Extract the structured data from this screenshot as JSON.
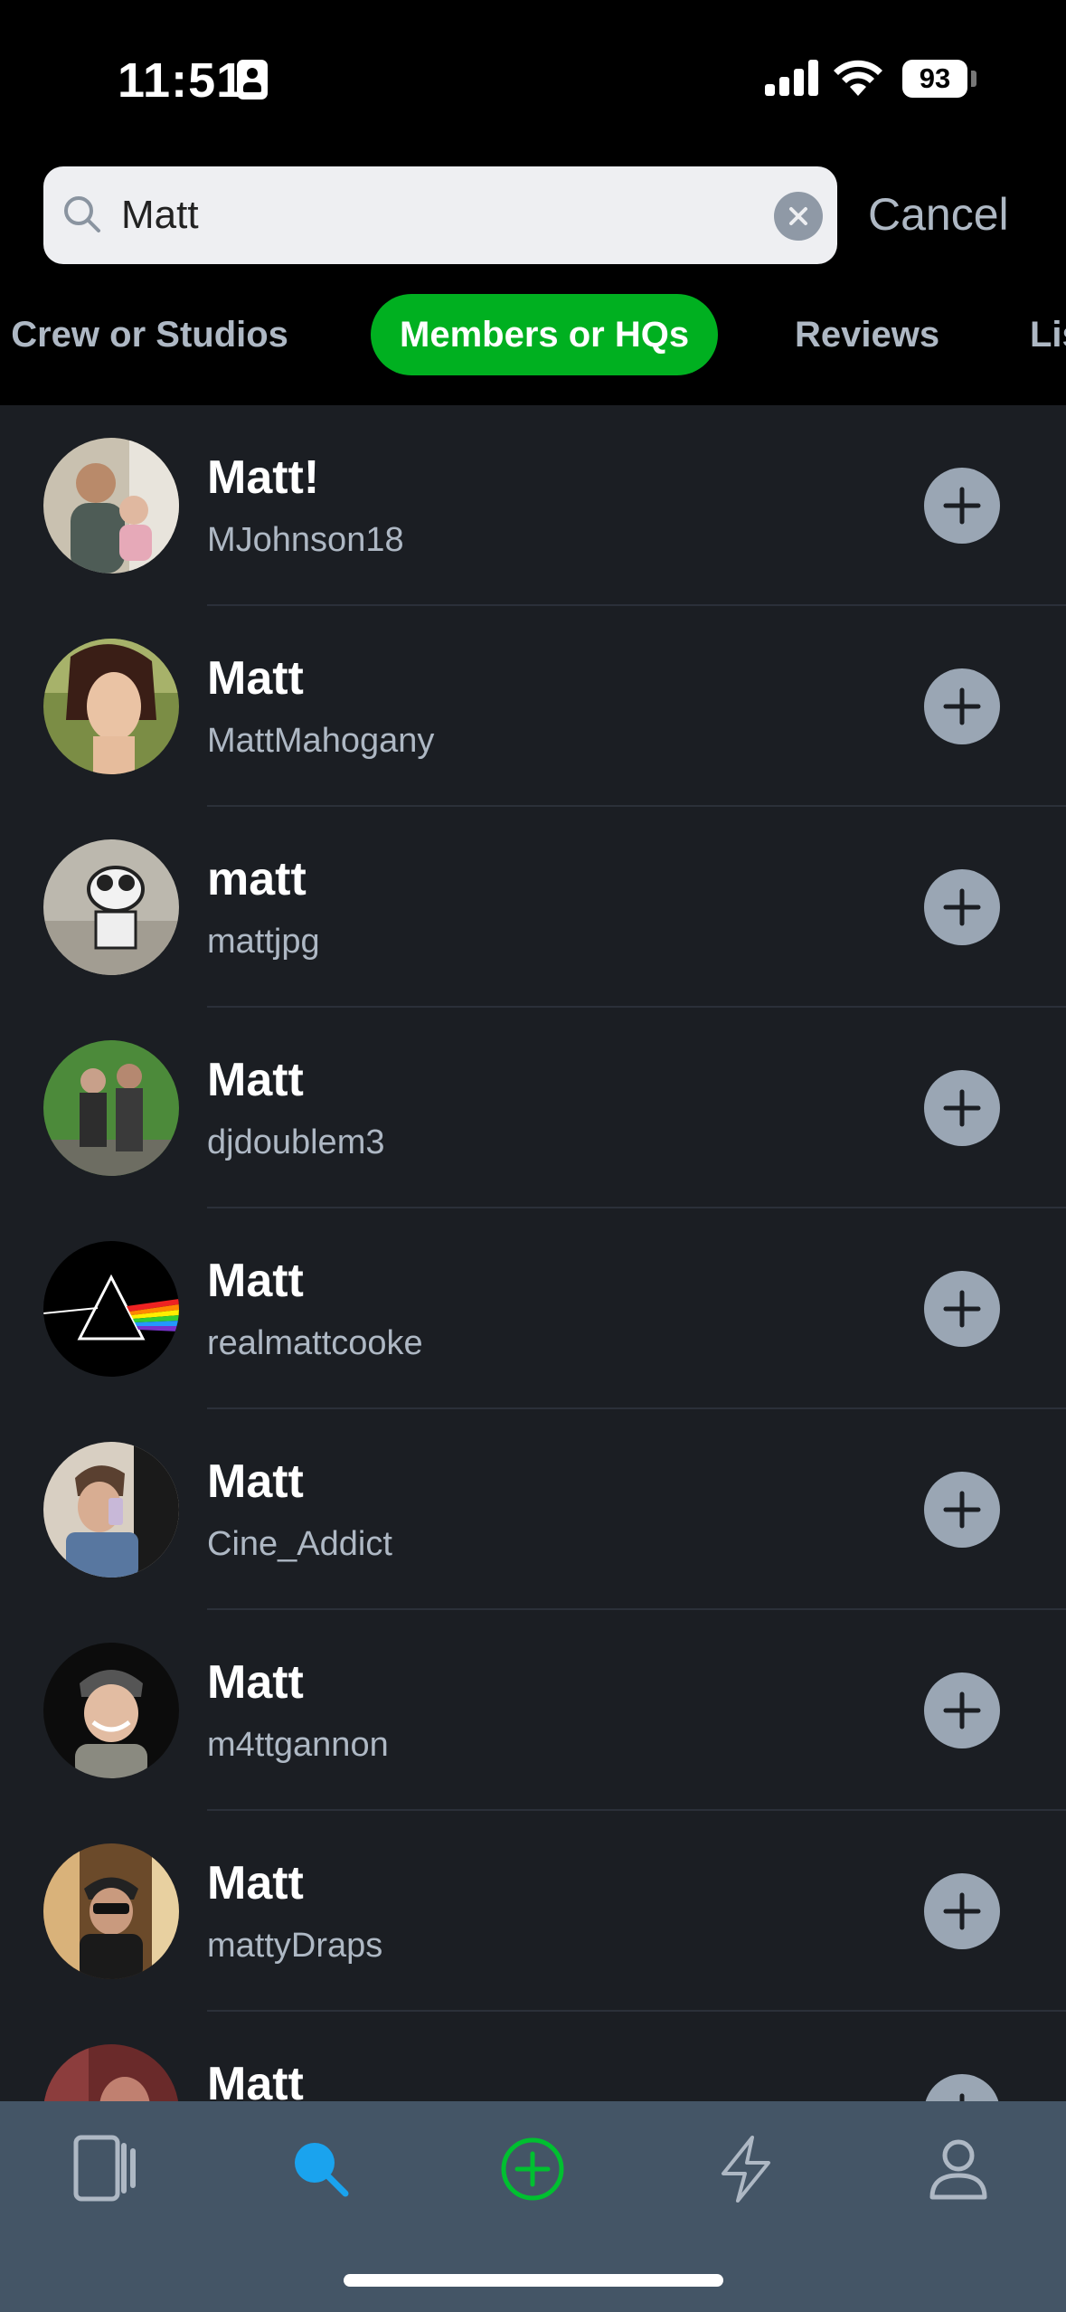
{
  "status_bar": {
    "time": "11:51",
    "battery": "93"
  },
  "search": {
    "value": "Matt",
    "clear_icon": "clear-circle-icon",
    "cancel_label": "Cancel"
  },
  "tabs": [
    {
      "label": ", Crew or Studios",
      "active": false
    },
    {
      "label": "Members or HQs",
      "active": true
    },
    {
      "label": "Reviews",
      "active": false
    },
    {
      "label": "Lis",
      "active": false
    }
  ],
  "results": [
    {
      "name": "Matt!",
      "handle": "MJohnson18"
    },
    {
      "name": "Matt",
      "handle": "MattMahogany"
    },
    {
      "name": "matt",
      "handle": "mattjpg"
    },
    {
      "name": "Matt",
      "handle": "djdoublem3"
    },
    {
      "name": "Matt",
      "handle": "realmattcooke"
    },
    {
      "name": "Matt",
      "handle": "Cine_Addict"
    },
    {
      "name": "Matt",
      "handle": "m4ttgannon"
    },
    {
      "name": "Matt",
      "handle": "mattyDraps"
    },
    {
      "name": "Matt",
      "handle": ""
    }
  ],
  "bottom_nav": [
    {
      "icon": "films-icon",
      "active": false
    },
    {
      "icon": "search-icon",
      "active": true
    },
    {
      "icon": "add-circle-icon",
      "active": false
    },
    {
      "icon": "activity-bolt-icon",
      "active": false
    },
    {
      "icon": "profile-icon",
      "active": false
    }
  ],
  "colors": {
    "accent": "#00b020",
    "background": "#1b1e23",
    "tabbar": "#445566",
    "muted_text": "#aeb8c4",
    "search_active": "#1aa3ee"
  }
}
